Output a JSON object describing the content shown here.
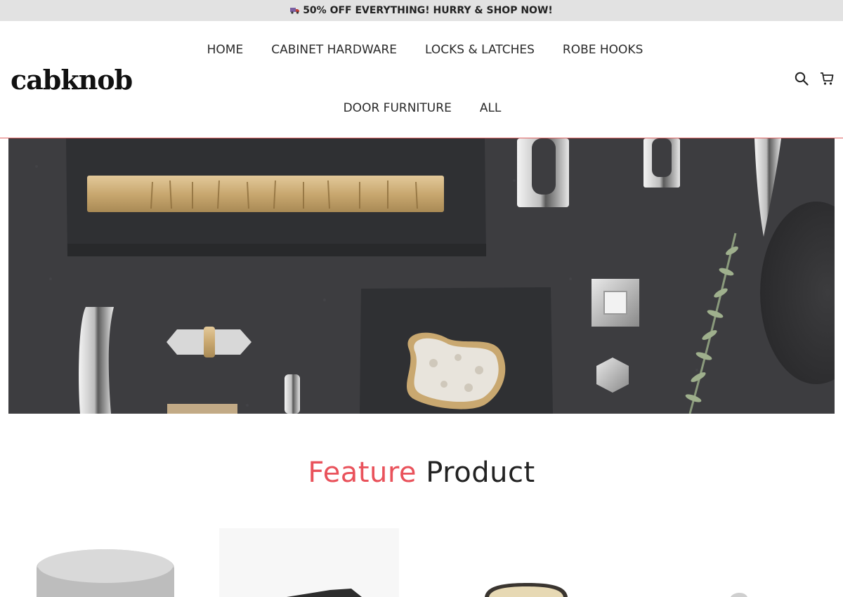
{
  "announcement": {
    "text": "50% OFF EVERYTHING! HURRY & SHOP NOW!",
    "icon": "truck-icon"
  },
  "header": {
    "logo": "cabknob",
    "nav_row1": [
      "HOME",
      "CABINET HARDWARE",
      "LOCKS & LATCHES",
      "ROBE HOOKS"
    ],
    "nav_row2": [
      "DOOR FURNITURE",
      "ALL"
    ],
    "icons": [
      "search-icon",
      "cart-icon"
    ]
  },
  "hero": {
    "image": "hardware-flatlay-image"
  },
  "feature": {
    "title_word1": "Feature",
    "title_word2": "Product"
  },
  "colors": {
    "announce_bg": "#e2e2e2",
    "accent": "#e9525b",
    "hero_bg": "#3b3b3d"
  }
}
